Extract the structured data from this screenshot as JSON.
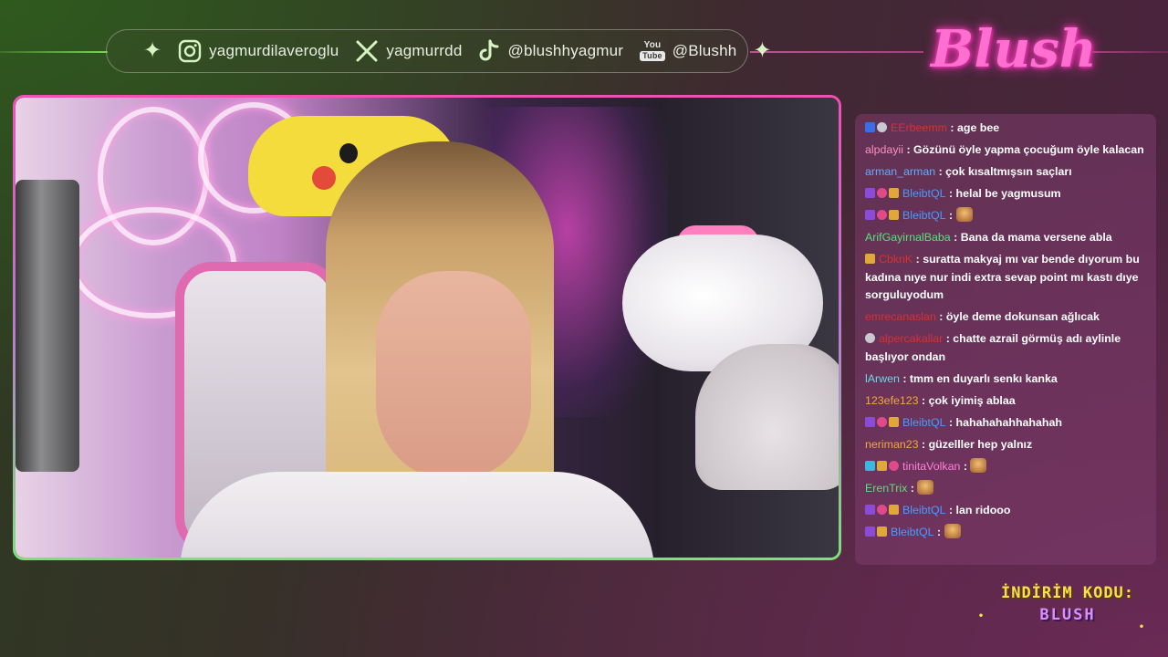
{
  "social": {
    "instagram": "yagmurdilaveroglu",
    "x": "yagmurrdd",
    "tiktok": "@blushhyagmur",
    "youtube_label": "You",
    "youtube_label2": "Tube",
    "youtube": "@Blushh"
  },
  "brand": {
    "logo_text": "Blush"
  },
  "chat": {
    "messages": [
      {
        "user": "EErbeemm",
        "user_color": "#d83030",
        "badges": [
          "blue",
          "grey"
        ],
        "text": "age bee"
      },
      {
        "user": "alpdayii",
        "user_color": "#ff8fbf",
        "badges": [],
        "text": "Gözünü öyle yapma çocuğum öyle kalacan"
      },
      {
        "user": "arman_arman",
        "user_color": "#6aa8ff",
        "badges": [],
        "text": "çok kısaltmışsın saçları"
      },
      {
        "user": "BleibtQL",
        "user_color": "#4a9aff",
        "badges": [
          "purple",
          "pink",
          "gold"
        ],
        "text": "helal be yagmusum"
      },
      {
        "user": "BleibtQL",
        "user_color": "#4a9aff",
        "badges": [
          "purple",
          "pink",
          "gold"
        ],
        "text": "",
        "emote": true
      },
      {
        "user": "ArifGayirnalBaba",
        "user_color": "#5ae07a",
        "badges": [],
        "text": "Bana da mama versene abla"
      },
      {
        "user": "CbknK",
        "user_color": "#d83030",
        "badges": [
          "gold"
        ],
        "text": "suratta makyaj mı var bende dıyorum bu kadına nıye nur indi extra sevap point mı kastı dıye sorguluyodum"
      },
      {
        "user": "emrecanaslan",
        "user_color": "#d83030",
        "badges": [],
        "text": "öyle deme dokunsan ağlıcak"
      },
      {
        "user": "alpercakallar",
        "user_color": "#d83030",
        "badges": [
          "grey"
        ],
        "text": "chatte azrail görmüş adı aylinle başlıyor ondan"
      },
      {
        "user": "lArwen",
        "user_color": "#6ad8e8",
        "badges": [],
        "text": "tmm en duyarlı senkı kanka"
      },
      {
        "user": "123efe123",
        "user_color": "#f0a83a",
        "badges": [],
        "text": "çok iyimiş ablaa"
      },
      {
        "user": "BleibtQL",
        "user_color": "#4a9aff",
        "badges": [
          "purple",
          "pink",
          "gold"
        ],
        "text": "hahahahahhahahah"
      },
      {
        "user": "neriman23",
        "user_color": "#f0a83a",
        "badges": [],
        "text": "güzelller hep yalnız"
      },
      {
        "user": "tinitaVolkan",
        "user_color": "#ff7fd8",
        "badges": [
          "cyan",
          "gold",
          "pink"
        ],
        "text": "",
        "emote": true
      },
      {
        "user": "ErenTrix",
        "user_color": "#5ae07a",
        "badges": [],
        "text": "",
        "emote": true
      },
      {
        "user": "BleibtQL",
        "user_color": "#4a9aff",
        "badges": [
          "purple",
          "pink",
          "gold"
        ],
        "text": "lan ridooo"
      },
      {
        "user": "BleibtQL",
        "user_color": "#4a9aff",
        "badges": [
          "purple",
          "gold"
        ],
        "text": "",
        "emote": true
      }
    ]
  },
  "promo": {
    "line1": "İNDİRİM KODU:",
    "line2": "BLUSH"
  }
}
